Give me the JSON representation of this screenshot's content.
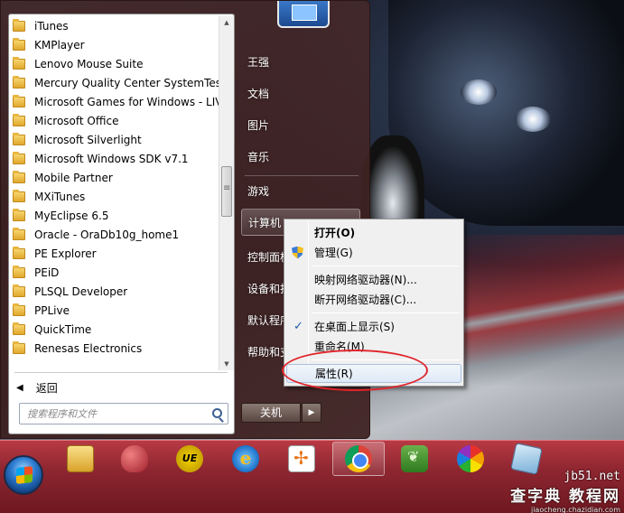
{
  "start_menu": {
    "programs": [
      "iTunes",
      "KMPlayer",
      "Lenovo Mouse Suite",
      "Mercury Quality Center SystemTest",
      "Microsoft Games for Windows - LIV",
      "Microsoft Office",
      "Microsoft Silverlight",
      "Microsoft Windows SDK v7.1",
      "Mobile Partner",
      "MXiTunes",
      "MyEclipse 6.5",
      "Oracle - OraDb10g_home1",
      "PE Explorer",
      "PEiD",
      "PLSQL Developer",
      "PPLive",
      "QuickTime",
      "Renesas Electronics"
    ],
    "back_label": "返回",
    "search_placeholder": "搜索程序和文件",
    "right_items": [
      "王强",
      "文档",
      "图片",
      "音乐",
      "游戏",
      "计算机",
      "控制面板",
      "设备和打印机",
      "默认程序",
      "帮助和支持"
    ],
    "shutdown_label": "关机",
    "shutdown_arrow": "▶"
  },
  "context_menu": {
    "items": [
      "打开(O)",
      "管理(G)",
      "映射网络驱动器(N)...",
      "断开网络驱动器(C)...",
      "在桌面上显示(S)",
      "重命名(M)",
      "属性(R)"
    ],
    "check_mark": "✓"
  },
  "taskbar": {
    "icons": [
      "explorer-icon",
      "database-icon",
      "ultraedit-icon",
      "internet-explorer-icon",
      "app-icon",
      "chrome-icon",
      "evernote-icon",
      "pinwheel-icon",
      "tablet-icon"
    ],
    "ue_text": "UE",
    "ie_text": "e"
  },
  "watermark": {
    "site": "jb51.net",
    "text": "查字典 教程网",
    "url": "jiaocheng.chazidian.com"
  },
  "colors": {
    "highlight_ellipse": "#e0242b",
    "taskbar": "#8e2630"
  }
}
